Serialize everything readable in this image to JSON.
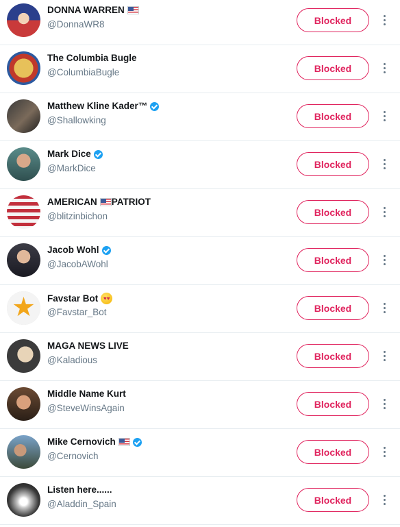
{
  "colors": {
    "accent": "#e0245e",
    "verified": "#1da1f2",
    "handle": "#657786",
    "divider": "#e6ecf0"
  },
  "accounts": [
    {
      "name": "DONNA WARREN",
      "handle": "@DonnaWR8",
      "badge": "us-flag-icon",
      "button": "Blocked"
    },
    {
      "name": "The Columbia Bugle",
      "handle": "@ColumbiaBugle",
      "badge": "",
      "button": "Blocked"
    },
    {
      "name": "Matthew Kline Kader™",
      "handle": "@Shallowking",
      "badge": "verified-icon",
      "button": "Blocked"
    },
    {
      "name": "Mark Dice",
      "handle": "@MarkDice",
      "badge": "verified-icon",
      "button": "Blocked"
    },
    {
      "name": "AMERICAN",
      "name_suffix": "PATRIOT",
      "handle": "@blitzinbichon",
      "badge": "us-flag-icon",
      "button": "Blocked"
    },
    {
      "name": "Jacob Wohl",
      "handle": "@JacobAWohl",
      "badge": "verified-icon",
      "button": "Blocked"
    },
    {
      "name": "Favstar Bot",
      "handle": "@Favstar_Bot",
      "badge": "heart-eyes-emoji-icon",
      "button": "Blocked"
    },
    {
      "name": "MAGA NEWS LIVE",
      "handle": "@Kaladious",
      "badge": "",
      "button": "Blocked"
    },
    {
      "name": "Middle Name Kurt",
      "handle": "@SteveWinsAgain",
      "badge": "",
      "button": "Blocked"
    },
    {
      "name": "Mike Cernovich",
      "handle": "@Cernovich",
      "badge": "us-flag-icon verified-icon",
      "button": "Blocked"
    },
    {
      "name": "Listen here......",
      "handle": "@Aladdin_Spain",
      "badge": "",
      "button": "Blocked"
    }
  ]
}
